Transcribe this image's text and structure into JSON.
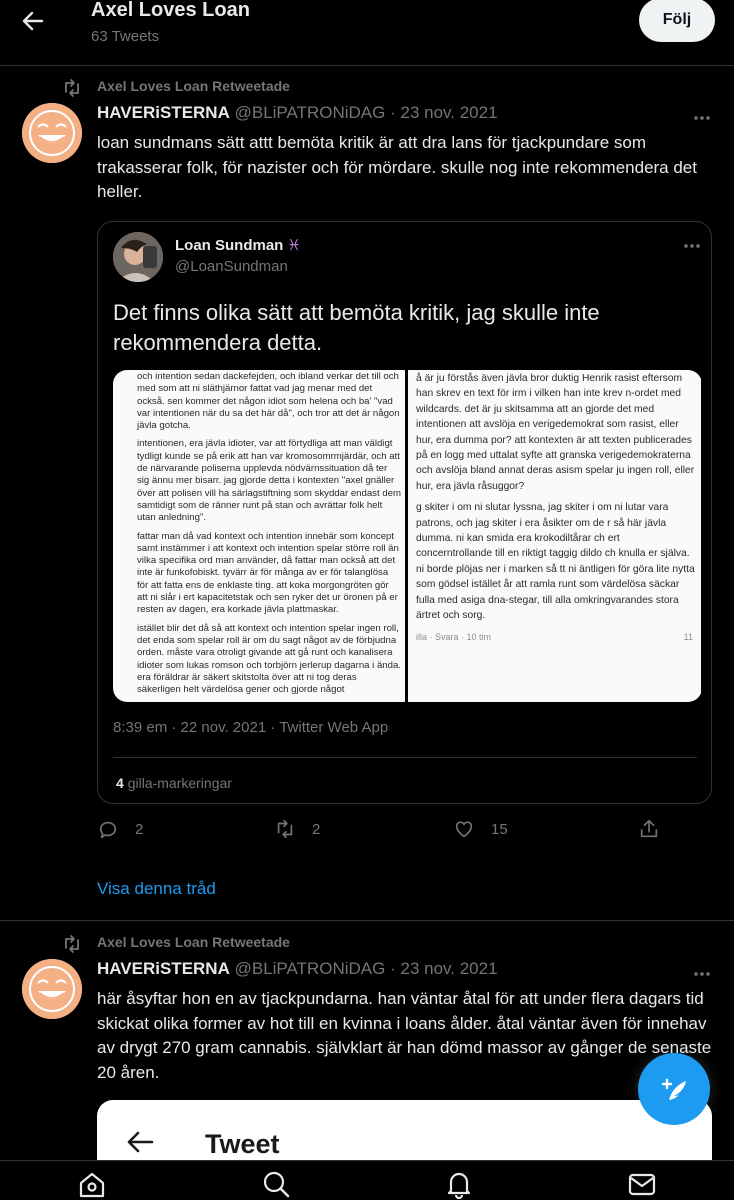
{
  "header": {
    "title": "Axel Loves Loan",
    "subtitle": "63 Tweets",
    "follow_label": "Följ"
  },
  "tweet1": {
    "retweet_label": "Axel Loves Loan Retweetade",
    "name": "HAVERiSTERNA",
    "handle": "@BLiPATRONiDAG",
    "date": "· 23 nov. 2021",
    "text": "loan sundmans sätt attt bemöta kritik är att dra lans för tjackpundare som trakasserar folk, för nazister och för mördare. skulle nog inte rekommendera det heller.",
    "quote": {
      "name": "Loan Sundman",
      "sign": "♓",
      "handle": "@LoanSundman",
      "text": "Det finns olika sätt att bemöta kritik, jag skulle inte rekommendera detta.",
      "timestamp": "8:39 em · 22 nov. 2021 · Twitter Web App",
      "likes_count": "4",
      "likes_label": "gilla-markeringar",
      "media_left_paragraphs": [
        "och intention sedan dackefejden, och ibland verkar det till och med som att ni släthjärnor fattat vad jag menar med det också. sen kommer det någon idiot som helena och ba' \"vad var intentionen när du sa det här då\", och tror att det är någon jävla gotcha.",
        "intentionen, era jävla idioter, var att förtydliga att man väldigt tydligt kunde se på erik att han var kromosomrmjärdär, och att de närvarande poliserna upplevda nödvärnssituation då ter sig ännu mer bisarr. jag gjorde detta i kontexten \"axel gnäller över att polisen vill ha särlagstiftning som skyddar endast dem samtidigt som de ränner runt på stan och avrättar folk helt utan anledning\".",
        "fattar man då vad kontext och intention innebär som koncept samt instämmer i att kontext och intention spelar större roll än vilka specifika ord man använder, då fattar man också att det inte är funkofobiskt. tyvärr är för många av er för talanglösa för att fatta ens de enklaste ting. att koka morgongröten gör att ni slår i ert kapacitetstak och sen ryker det ur öronen på er resten av dagen, era korkade jävla plattmaskar.",
        "istället blir det då så att kontext och intention spelar ingen roll, det enda som spelar roll är om du sagt något av de förbjudna orden. måste vara otroligt givande att gå runt och kanalisera idioter som lukas romson och torbjörn jerlerup dagarna i ända. era föräldrar är säkert skitstolta över att ni tog deras säkerligen helt värdelösa gener och gjorde något"
      ],
      "media_right_paragraphs": [
        "å är ju förstås även jävla bror duktig Henrik rasist eftersom han skrev en text för irm i vilken han inte krev n-ordet med wildcards. det är ju skitsamma att an gjorde det med intentionen att avslöja en verigedemokrat som rasist, eller hur, era dumma por? att kontexten är att texten publicerades på en logg med uttalat syfte att granska verigedemokraterna och avslöja bland annat deras asism spelar ju ingen roll, eller hur, era jävla råsuggor?",
        "g skiter i om ni slutar lyssna, jag skiter i om ni lutar vara patrons, och jag skiter i era åsikter om de r så här jävla dumma. ni kan smida era krokodiltårar ch ert concerntrollande till en riktigt taggig dildo ch knulla er själva. ni borde plöjas ner i marken så tt ni äntligen för göra lite nytta som gödsel istället år att ramla runt som värdelösa säckar fulla med asiga dna-stegar, till alla omkringvarandes stora ärtret och sorg."
      ],
      "media_right_footer": "illa · Svara · 10 tim",
      "media_right_reactions": "11"
    },
    "reply_count": "2",
    "retweet_count": "2",
    "like_count": "15",
    "show_thread": "Visa denna tråd"
  },
  "tweet2": {
    "retweet_label": "Axel Loves Loan Retweetade",
    "name": "HAVERiSTERNA",
    "handle": "@BLiPATRONiDAG",
    "date": "· 23 nov. 2021",
    "text": "här åsyftar hon en av tjackpundarna. han väntar åtal för att under flera dagars tid skickat olika former av hot till en kvinna i loans ålder. åtal väntar även för innehav av drygt 270 gram cannabis. självklart är han dömd massor av gånger de senaste 20 åren.",
    "embed_title": "Tweet"
  },
  "colors": {
    "accent": "#1d9bf0",
    "background": "#000000",
    "text": "#e7e9ea",
    "muted": "#71767b",
    "border": "#2f3336"
  },
  "icons": [
    "back-arrow-icon",
    "retweet-icon",
    "more-icon",
    "reply-icon",
    "like-icon",
    "share-icon",
    "compose-icon",
    "home-icon",
    "search-icon",
    "notifications-icon",
    "messages-icon"
  ]
}
